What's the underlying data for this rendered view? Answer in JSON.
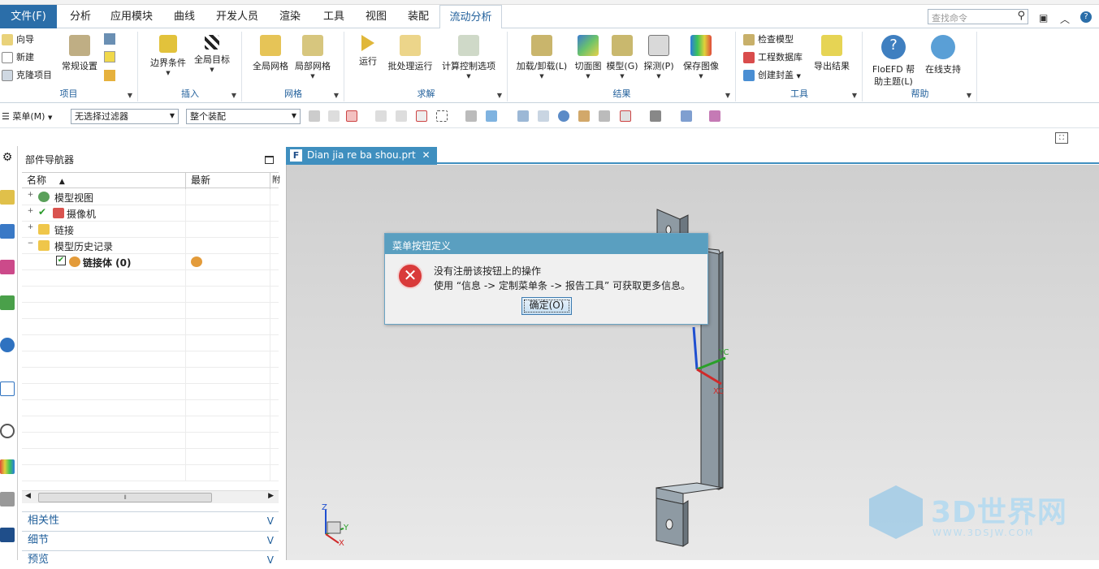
{
  "menubar": {
    "tabs": [
      "文件(F)",
      "分析",
      "应用模块",
      "曲线",
      "开发人员",
      "渲染",
      "工具",
      "视图",
      "装配",
      "流动分析"
    ],
    "active_tab": "流动分析",
    "search_placeholder": "查找命令"
  },
  "ribbon": {
    "groups": [
      {
        "label": "项目",
        "small": [
          "向导",
          "新建",
          "克隆项目"
        ],
        "big": [
          "常规设置"
        ]
      },
      {
        "label": "插入",
        "big": [
          "边界条件",
          "全局目标"
        ]
      },
      {
        "label": "网格",
        "big": [
          "全局网格",
          "局部网格"
        ]
      },
      {
        "label": "求解",
        "big": [
          "运行",
          "批处理运行",
          "计算控制选项"
        ]
      },
      {
        "label": "结果",
        "big": [
          "加载/卸载(L)",
          "切面图",
          "模型(G)",
          "探测(P)",
          "保存图像"
        ]
      },
      {
        "label": "工具",
        "small": [
          "检查模型",
          "工程数据库",
          "创建封盖"
        ],
        "big": [
          "导出结果"
        ]
      },
      {
        "label": "帮助",
        "big": [
          "FloEFD 帮助主题(L)",
          "在线支持"
        ]
      }
    ]
  },
  "toolbar2": {
    "menu_label": "菜单(M)",
    "filter_value": "无选择过滤器",
    "assembly_value": "整个装配"
  },
  "navigator": {
    "title": "部件导航器",
    "columns": [
      "名称",
      "最新",
      "附"
    ],
    "rows": [
      {
        "label": "模型视图"
      },
      {
        "label": "摄像机"
      },
      {
        "label": "链接"
      },
      {
        "label": "模型历史记录"
      },
      {
        "label": "链接体 (0)"
      }
    ],
    "accordions": [
      "相关性",
      "细节",
      "预览"
    ]
  },
  "document_tab": {
    "name": "Dian jia re ba shou.prt",
    "close": "✕"
  },
  "dialog": {
    "title": "菜单按钮定义",
    "message1": "没有注册该按钮上的操作",
    "message2": "使用 “信息 -> 定制菜单条 -> 报告工具” 可获取更多信息。",
    "ok_label": "确定(O)"
  },
  "viewport": {
    "axes": {
      "z": "Z",
      "y": "Y",
      "x": "X",
      "zc": "ZC",
      "yc": "YC",
      "xc": "XC"
    }
  },
  "watermark": {
    "title": "3D世界网",
    "url": "WWW.3DSJW.COM"
  },
  "colors": {
    "accent": "#2b6ea9",
    "dialog_title": "#5a9fc0",
    "error_icon": "#d93a3a"
  }
}
